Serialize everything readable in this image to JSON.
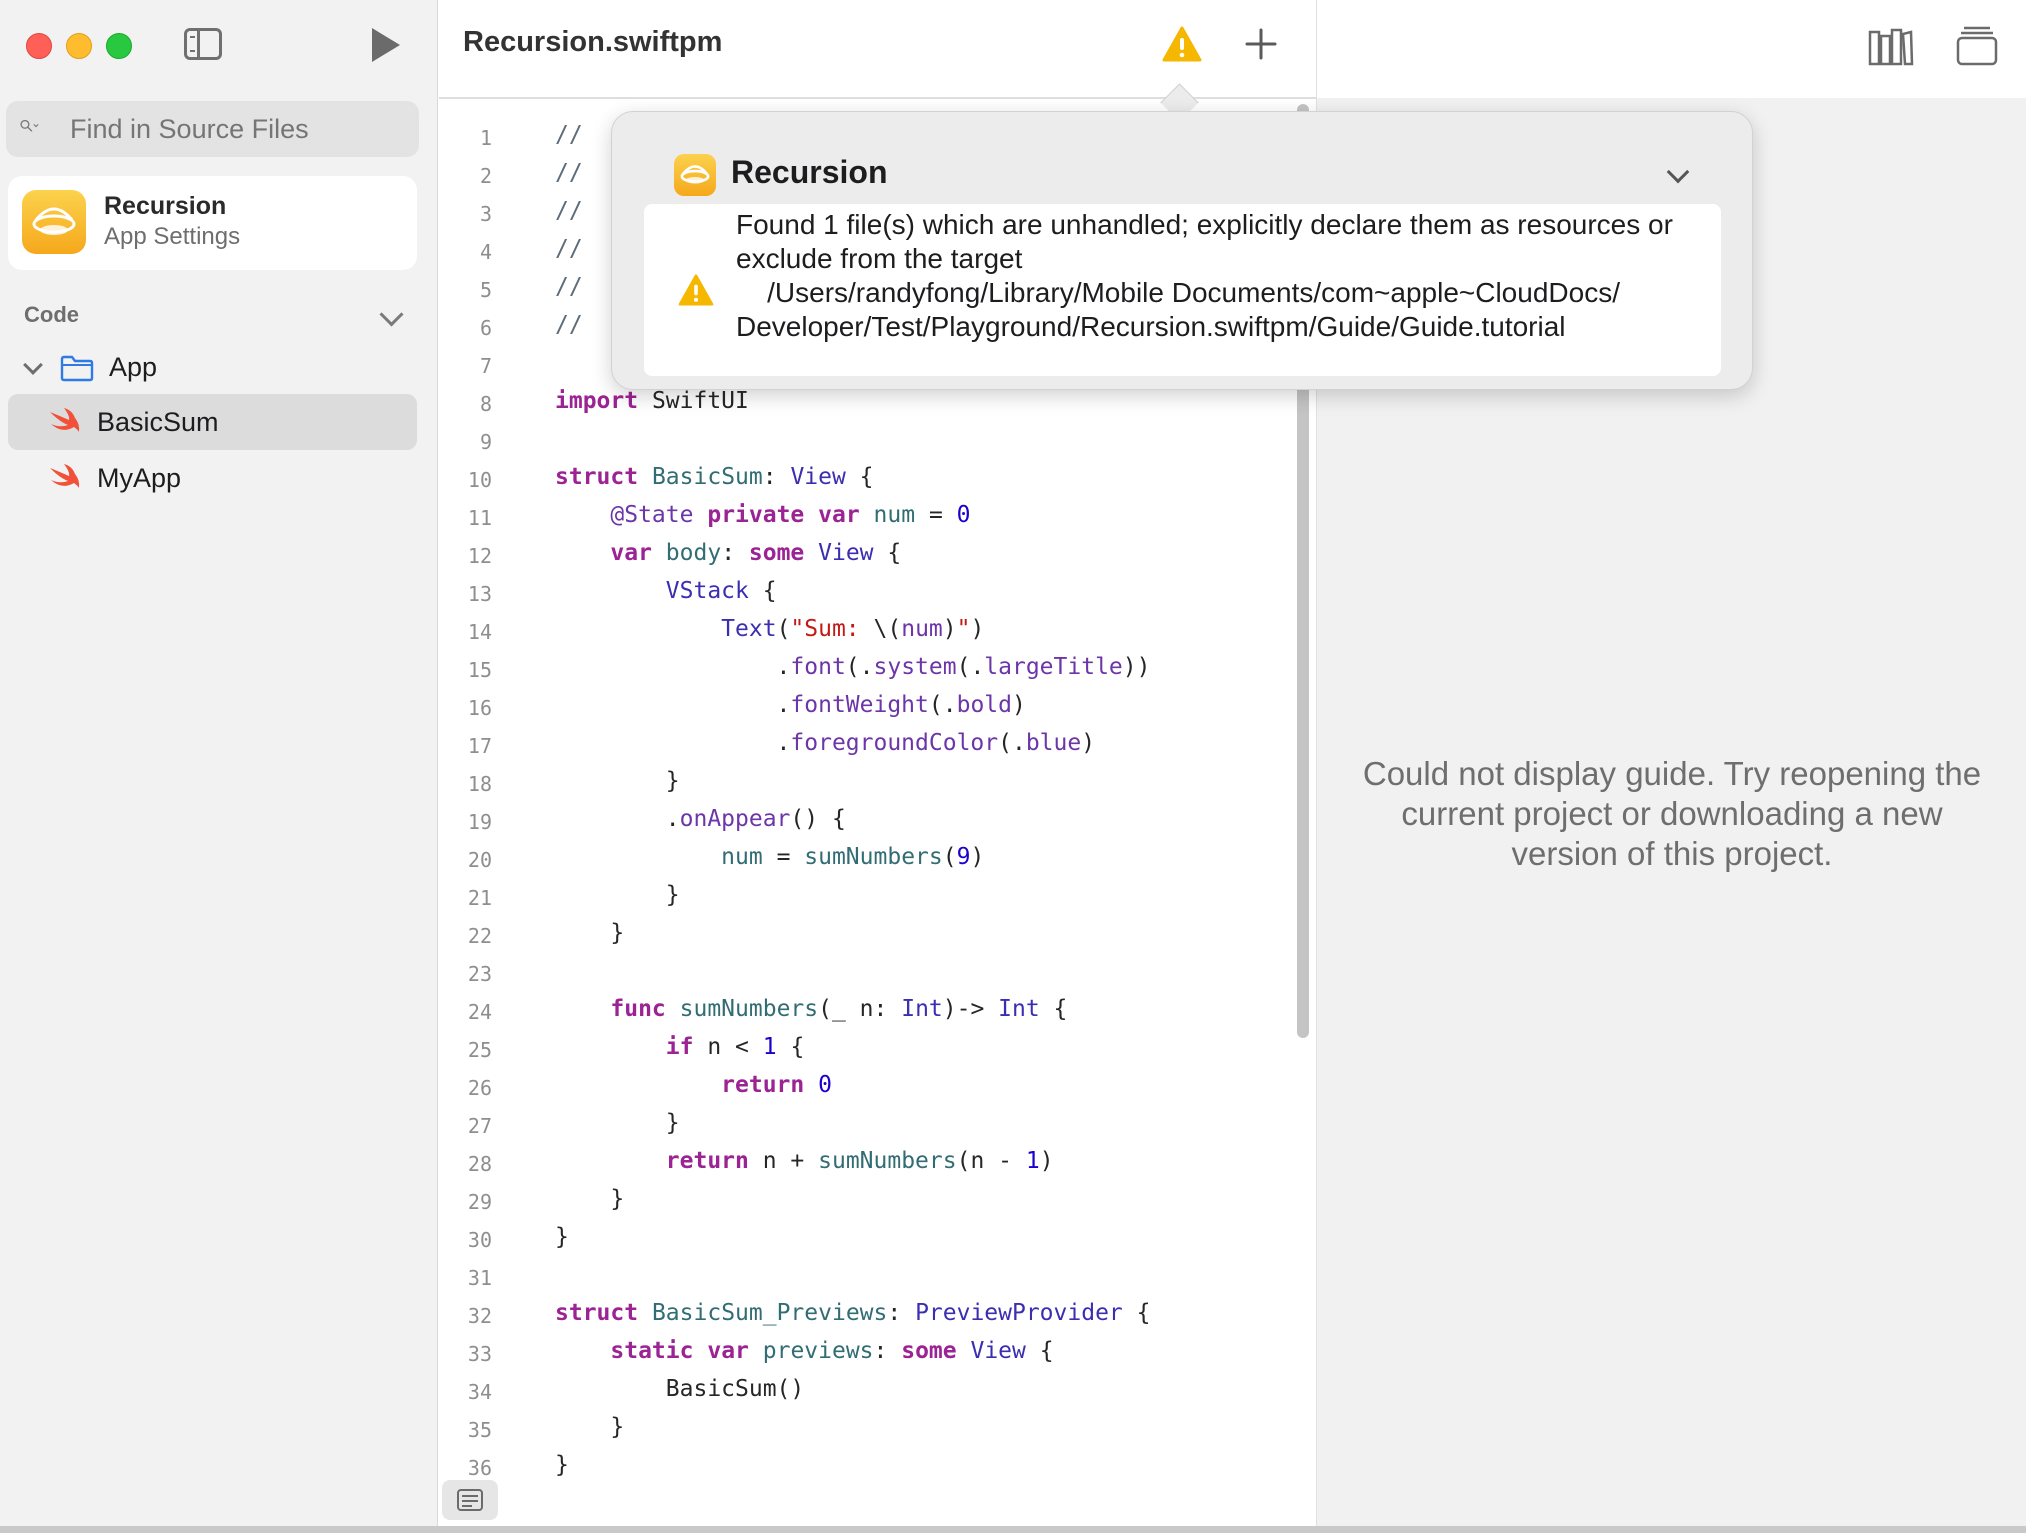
{
  "sidebar": {
    "search_placeholder": "Find in Source Files",
    "app_settings": {
      "title": "Recursion",
      "subtitle": "App Settings"
    },
    "section_header": "Code",
    "folder_label": "App",
    "files": [
      {
        "name": "BasicSum",
        "selected": true
      },
      {
        "name": "MyApp",
        "selected": false
      }
    ]
  },
  "toolbar": {
    "project_title": "Recursion.swiftpm"
  },
  "popover": {
    "title": "Recursion",
    "message": "Found 1 file(s) which are unhandled; explicitly declare them as resources or exclude from the target",
    "path_line1": "    /Users/randyfong/Library/Mobile Documents/com~apple~CloudDocs/",
    "path_line2": "Developer/Test/Playground/Recursion.swiftpm/Guide/Guide.tutorial"
  },
  "guide": {
    "message": "Could not display guide. Try reopening the current project or downloading a new version of this project."
  },
  "editor": {
    "lines": [
      {
        "n": "1",
        "src": "//"
      },
      {
        "n": "2",
        "src": "//"
      },
      {
        "n": "3",
        "src": "//"
      },
      {
        "n": "4",
        "src": "//"
      },
      {
        "n": "5",
        "src": "//"
      },
      {
        "n": "6",
        "src": "//"
      },
      {
        "n": "7",
        "src": ""
      },
      {
        "n": "8",
        "src": "import SwiftUI"
      },
      {
        "n": "9",
        "src": ""
      },
      {
        "n": "10",
        "src": "struct BasicSum: View {"
      },
      {
        "n": "11",
        "src": "    @State private var num = 0"
      },
      {
        "n": "12",
        "src": "    var body: some View {"
      },
      {
        "n": "13",
        "src": "        VStack {"
      },
      {
        "n": "14",
        "src": "            Text(\"Sum: \\(num)\")"
      },
      {
        "n": "15",
        "src": "                .font(.system(.largeTitle))"
      },
      {
        "n": "16",
        "src": "                .fontWeight(.bold)"
      },
      {
        "n": "17",
        "src": "                .foregroundColor(.blue)"
      },
      {
        "n": "18",
        "src": "        }"
      },
      {
        "n": "19",
        "src": "        .onAppear() {"
      },
      {
        "n": "20",
        "src": "            num = sumNumbers(9)"
      },
      {
        "n": "21",
        "src": "        }"
      },
      {
        "n": "22",
        "src": "    }"
      },
      {
        "n": "23",
        "src": ""
      },
      {
        "n": "24",
        "src": "    func sumNumbers(_ n: Int)-> Int {"
      },
      {
        "n": "25",
        "src": "        if n < 1 {"
      },
      {
        "n": "26",
        "src": "            return 0"
      },
      {
        "n": "27",
        "src": "        }"
      },
      {
        "n": "28",
        "src": "        return n + sumNumbers(n - 1)"
      },
      {
        "n": "29",
        "src": "    }"
      },
      {
        "n": "30",
        "src": "}"
      },
      {
        "n": "31",
        "src": ""
      },
      {
        "n": "32",
        "src": "struct BasicSum_Previews: PreviewProvider {"
      },
      {
        "n": "33",
        "src": "    static var previews: some View {"
      },
      {
        "n": "34",
        "src": "        BasicSum()"
      },
      {
        "n": "35",
        "src": "    }"
      },
      {
        "n": "36",
        "src": "}"
      }
    ]
  },
  "colors": {
    "keyword": "#9b2393",
    "type": "#3b2eb0",
    "function": "#326d74",
    "property": "#6c36a9",
    "string": "#c41a16",
    "number": "#1c00cf",
    "warning": "#f5b700"
  },
  "icons": [
    "sidebar-toggle-icon",
    "run-icon",
    "search-icon",
    "warning-icon",
    "plus-icon",
    "library-icon",
    "window-icon",
    "folder-icon",
    "swift-file-icon",
    "chevron-down-icon"
  ]
}
